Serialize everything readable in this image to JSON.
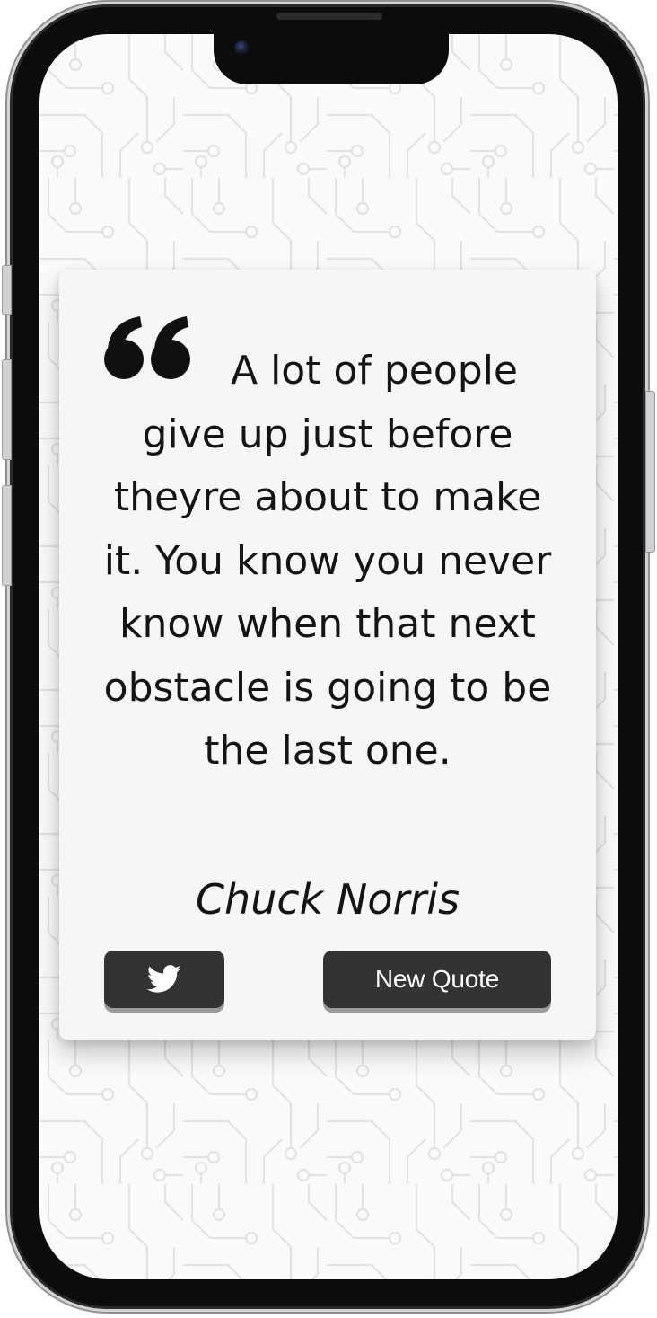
{
  "quote": {
    "text": "A lot of people give up just before theyre about to make it. You know you never know when that next obstacle is going to be the last one.",
    "author": "Chuck Norris",
    "quote_icon": "quote-mark-icon"
  },
  "buttons": {
    "tweet_icon": "twitter-icon",
    "new_quote_label": "New Quote"
  },
  "colors": {
    "button_bg": "#333333",
    "card_bg": "#f6f6f6",
    "text": "#141414",
    "background_pattern": "#e2e2e2"
  }
}
